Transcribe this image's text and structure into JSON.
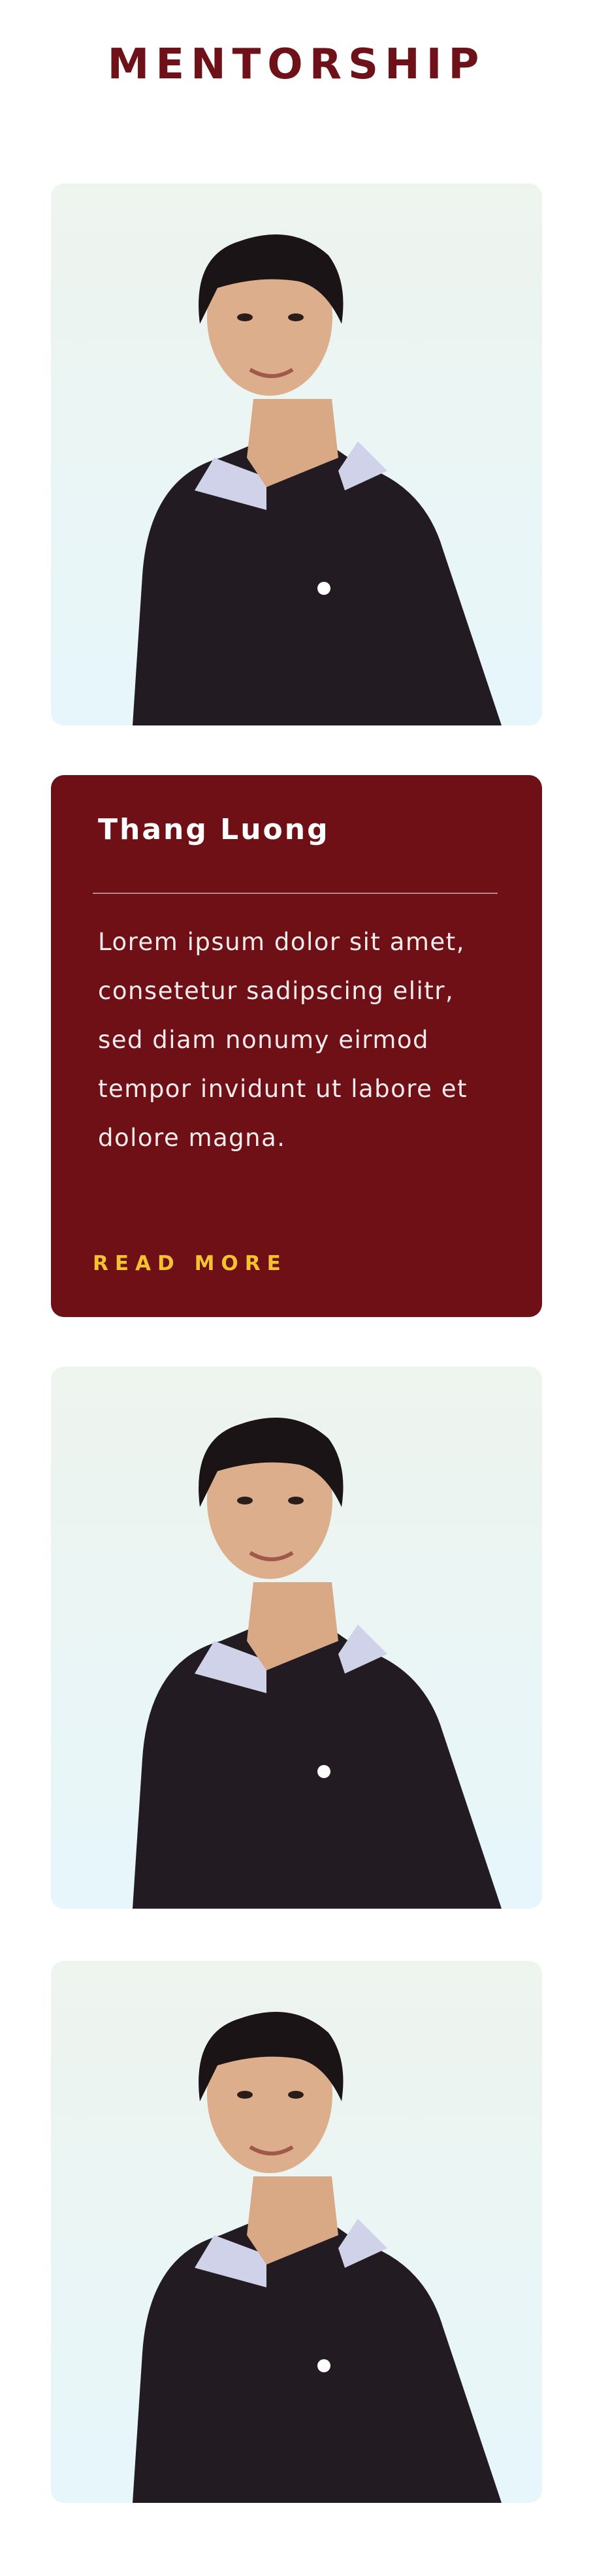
{
  "section": {
    "title": "MENTORSHIP"
  },
  "mentor": {
    "name": "Thang Luong",
    "description": "Lorem ipsum dolor sit amet, consetetur sadipscing elitr, sed diam nonumy eirmod tempor invidunt ut labore et dolore magna.",
    "read_more_label": "READ MORE"
  },
  "colors": {
    "title": "#6e1118",
    "card_background": "#6e1016",
    "accent": "#f2c230"
  }
}
